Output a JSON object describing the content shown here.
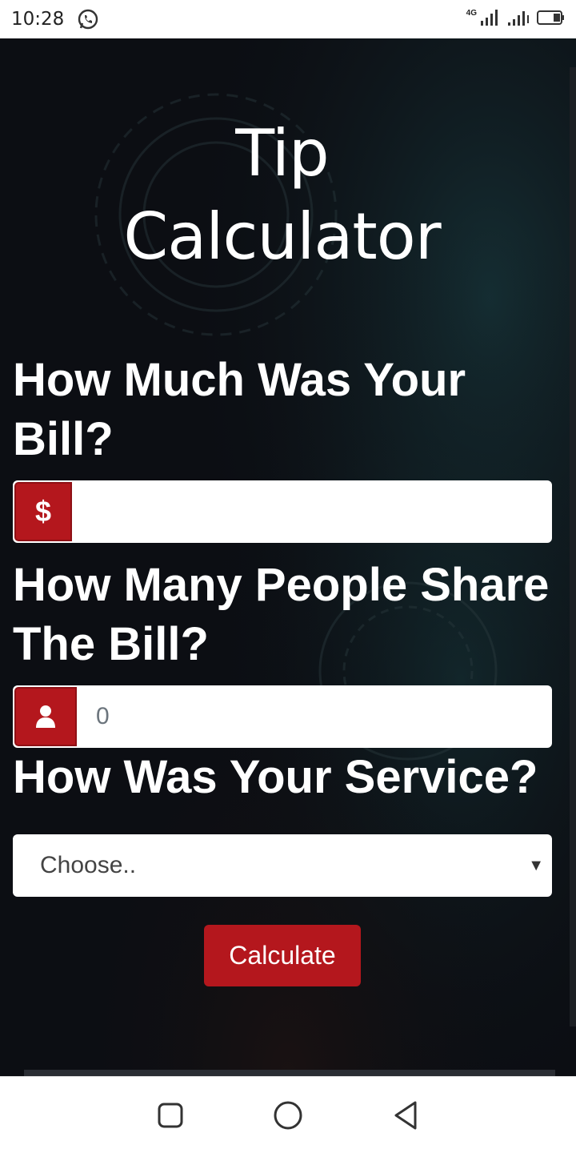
{
  "status_bar": {
    "time": "10:28",
    "network_label": "4G",
    "icons": [
      "whatsapp-icon",
      "signal-icon",
      "signal-icon",
      "battery-icon"
    ]
  },
  "app": {
    "title_line1": "Tip",
    "title_line2": "Calculator",
    "bill_question": "How Much Was Your Bill?",
    "bill_addon_symbol": "$",
    "bill_placeholder": "",
    "people_question": "How Many People Share The Bill?",
    "people_placeholder": "0",
    "service_question": "How Was Your Service?",
    "service_select_value": "Choose..",
    "calculate_label": "Calculate"
  },
  "colors": {
    "accent": "#b4171d",
    "background": "#0c0e13",
    "text": "#ffffff"
  },
  "nav_bar": {
    "icons": [
      "recent-apps-icon",
      "home-icon",
      "back-icon"
    ]
  }
}
